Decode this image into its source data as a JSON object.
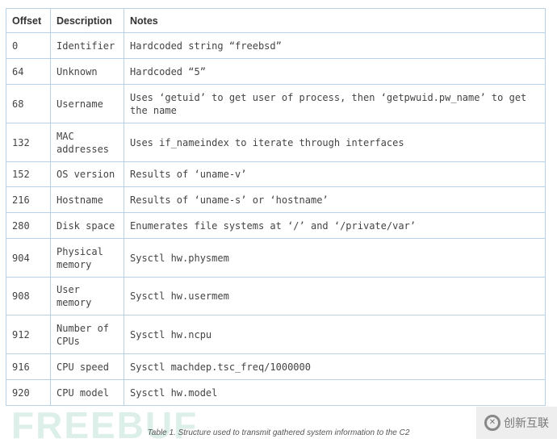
{
  "table": {
    "headers": [
      "Offset",
      "Description",
      "Notes"
    ],
    "rows": [
      [
        "0",
        "Identifier",
        "Hardcoded string “freebsd”"
      ],
      [
        "64",
        "Unknown",
        "Hardcoded “5”"
      ],
      [
        "68",
        "Username",
        "Uses ‘getuid’ to get user of process, then ‘getpwuid.pw_name’ to get the name"
      ],
      [
        "132",
        "MAC addresses",
        "Uses if_nameindex to iterate through interfaces"
      ],
      [
        "152",
        "OS version",
        "Results of ‘uname-v’"
      ],
      [
        "216",
        "Hostname",
        "Results of ‘uname-s’ or ‘hostname’"
      ],
      [
        "280",
        "Disk space",
        "Enumerates file systems at ‘/’ and ‘/private/var’"
      ],
      [
        "904",
        "Physical memory",
        "Sysctl hw.physmem"
      ],
      [
        "908",
        "User memory",
        "Sysctl hw.usermem"
      ],
      [
        "912",
        "Number of CPUs",
        "Sysctl hw.ncpu"
      ],
      [
        "916",
        "CPU speed",
        "Sysctl machdep.tsc_freq/1000000"
      ],
      [
        "920",
        "CPU model",
        "Sysctl hw.model"
      ]
    ]
  },
  "caption": "Table 1. Structure used to transmit gathered system information to the C2",
  "watermark": "FREEBUF",
  "logo": "创新互联"
}
